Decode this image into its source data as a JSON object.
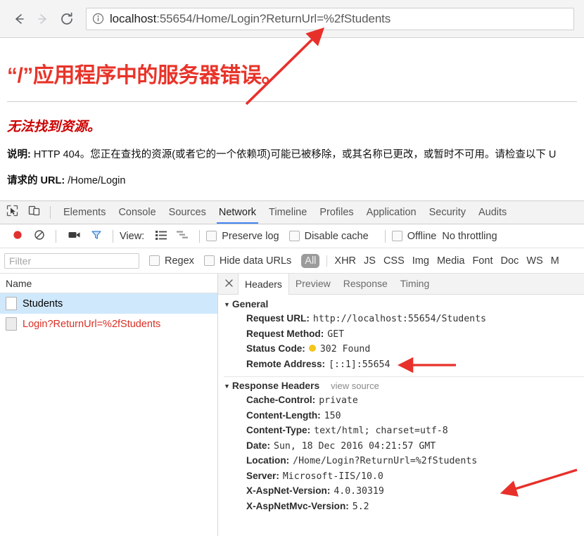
{
  "browser": {
    "back_icon": "arrow-left-icon",
    "forward_icon": "arrow-right-icon",
    "reload_icon": "reload-icon",
    "info_icon": "info-circle-icon",
    "url_host": "localhost",
    "url_rest": ":55654/Home/Login?ReturnUrl=%2fStudents",
    "url_full": "localhost:55654/Home/Login?ReturnUrl=%2fStudents"
  },
  "error_page": {
    "title": "“/”应用程序中的服务器错误。",
    "subtitle": "无法找到资源。",
    "description_label": "说明:",
    "description_value": "HTTP 404。您正在查找的资源(或者它的一个依赖项)可能已被移除，或其名称已更改，或暂时不可用。请检查以下 U",
    "requested_url_label": "请求的 URL:",
    "requested_url_value": "/Home/Login"
  },
  "devtools": {
    "inspect_icon": "inspect-element-icon",
    "device_icon": "device-toolbar-icon",
    "tabs": [
      {
        "label": "Elements",
        "active": false
      },
      {
        "label": "Console",
        "active": false
      },
      {
        "label": "Sources",
        "active": false
      },
      {
        "label": "Network",
        "active": true
      },
      {
        "label": "Timeline",
        "active": false
      },
      {
        "label": "Profiles",
        "active": false
      },
      {
        "label": "Application",
        "active": false
      },
      {
        "label": "Security",
        "active": false
      },
      {
        "label": "Audits",
        "active": false
      }
    ],
    "network_toolbar": {
      "record_icon": "record-button-icon",
      "clear_icon": "clear-icon",
      "camera_icon": "capture-screenshots-icon",
      "filter_icon": "filter-funnel-icon",
      "view_label": "View:",
      "list_view_icon": "list-view-icon",
      "waterfall_view_icon": "waterfall-view-icon",
      "preserve_log_label": "Preserve log",
      "disable_cache_label": "Disable cache",
      "offline_label": "Offline",
      "throttling_label": "No throttling"
    },
    "filter_bar": {
      "filter_placeholder": "Filter",
      "filter_value": "",
      "regex_label": "Regex",
      "hide_data_urls_label": "Hide data URLs",
      "types": [
        {
          "label": "All",
          "active": true
        },
        {
          "label": "XHR",
          "active": false
        },
        {
          "label": "JS",
          "active": false
        },
        {
          "label": "CSS",
          "active": false
        },
        {
          "label": "Img",
          "active": false
        },
        {
          "label": "Media",
          "active": false
        },
        {
          "label": "Font",
          "active": false
        },
        {
          "label": "Doc",
          "active": false
        },
        {
          "label": "WS",
          "active": false
        },
        {
          "label": "M",
          "active": false
        }
      ]
    },
    "request_list": {
      "column_header": "Name",
      "rows": [
        {
          "name": "Students",
          "selected": true,
          "red": false
        },
        {
          "name": "Login?ReturnUrl=%2fStudents",
          "selected": false,
          "red": true
        }
      ]
    },
    "detail": {
      "close_icon": "close-icon",
      "tabs": [
        {
          "label": "Headers",
          "active": true
        },
        {
          "label": "Preview",
          "active": false
        },
        {
          "label": "Response",
          "active": false
        },
        {
          "label": "Timing",
          "active": false
        }
      ],
      "general": {
        "title": "General",
        "rows": [
          {
            "key": "Request URL:",
            "value": "http://localhost:55654/Students",
            "dot": false
          },
          {
            "key": "Request Method:",
            "value": "GET",
            "dot": false
          },
          {
            "key": "Status Code:",
            "value": "302 Found",
            "dot": true,
            "dot_color": "#f5c518"
          },
          {
            "key": "Remote Address:",
            "value": "[::1]:55654",
            "dot": false
          }
        ]
      },
      "response_headers": {
        "title": "Response Headers",
        "view_source": "view source",
        "rows": [
          {
            "key": "Cache-Control:",
            "value": "private"
          },
          {
            "key": "Content-Length:",
            "value": "150"
          },
          {
            "key": "Content-Type:",
            "value": "text/html; charset=utf-8"
          },
          {
            "key": "Date:",
            "value": "Sun, 18 Dec 2016 04:21:57 GMT"
          },
          {
            "key": "Location:",
            "value": "/Home/Login?ReturnUrl=%2fStudents"
          },
          {
            "key": "Server:",
            "value": "Microsoft-IIS/10.0"
          },
          {
            "key": "X-AspNet-Version:",
            "value": "4.0.30319"
          },
          {
            "key": "X-AspNetMvc-Version:",
            "value": "5.2"
          }
        ]
      }
    }
  },
  "annotations": {
    "color": "#e8302a",
    "arrows": [
      {
        "name": "arrow-to-url",
        "desc": "points at ReturnUrl in address bar"
      },
      {
        "name": "arrow-to-status-code",
        "desc": "points at 302 Found"
      },
      {
        "name": "arrow-to-location-header",
        "desc": "points at Location header"
      }
    ]
  }
}
